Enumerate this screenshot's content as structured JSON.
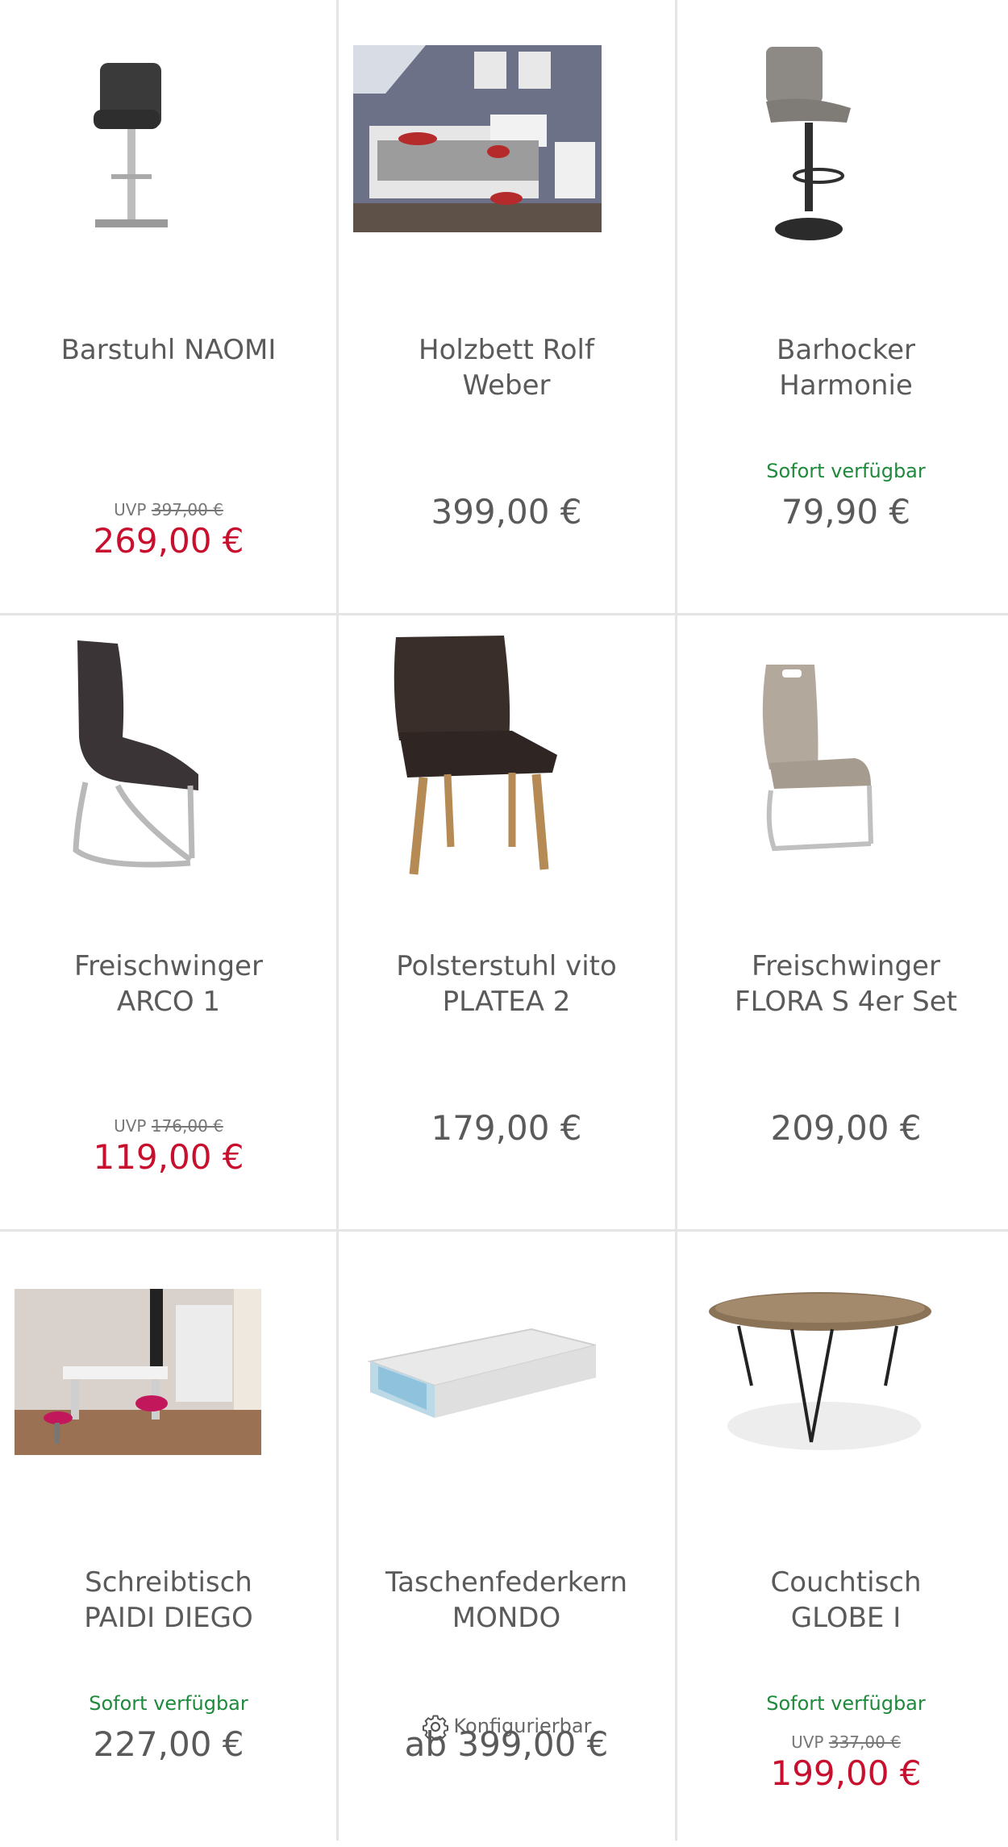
{
  "labels": {
    "uvp": "UVP",
    "available": "Sofort verfügbar",
    "configurable": "Konfigurierbar"
  },
  "products": [
    {
      "name": "Barstuhl NAOMI",
      "image": "bar-stool-black-image",
      "available": false,
      "configurable": false,
      "uvp": "397,00 €",
      "price": "269,00 €",
      "sale": true
    },
    {
      "name": "Holzbett Rolf\nWeber",
      "image": "wooden-bed-room-image",
      "available": false,
      "configurable": false,
      "uvp": null,
      "price": "399,00 €",
      "sale": false
    },
    {
      "name": "Barhocker\nHarmonie",
      "image": "bar-stool-grey-image",
      "available": true,
      "configurable": false,
      "uvp": null,
      "price": "79,90 €",
      "sale": false
    },
    {
      "name": "Freischwinger\nARCO 1",
      "image": "cantilever-chair-black-image",
      "available": false,
      "configurable": false,
      "uvp": "176,00 €",
      "price": "119,00 €",
      "sale": true
    },
    {
      "name": "Polsterstuhl vito\nPLATEA 2",
      "image": "upholstered-chair-image",
      "available": false,
      "configurable": false,
      "uvp": null,
      "price": "179,00 €",
      "sale": false
    },
    {
      "name": "Freischwinger\nFLORA S 4er Set",
      "image": "cantilever-chair-beige-image",
      "available": false,
      "configurable": false,
      "uvp": null,
      "price": "209,00 €",
      "sale": false
    },
    {
      "name": "Schreibtisch\nPAIDI DIEGO",
      "image": "desk-room-image",
      "available": true,
      "configurable": false,
      "uvp": null,
      "price": "227,00 €",
      "sale": false
    },
    {
      "name": "Taschenfederkern\nMONDO",
      "image": "mattress-image",
      "available": false,
      "configurable": true,
      "uvp": null,
      "price": "ab 399,00 €",
      "sale": false
    },
    {
      "name": "Couchtisch\nGLOBE I",
      "image": "coffee-table-image",
      "available": true,
      "configurable": false,
      "uvp": "337,00 €",
      "price": "199,00 €",
      "sale": true
    }
  ],
  "colors": {
    "sale_red": "#c8102e",
    "available_green": "#1f8a3c",
    "divider": "#e4e4e4",
    "text": "#5a5a5a"
  }
}
